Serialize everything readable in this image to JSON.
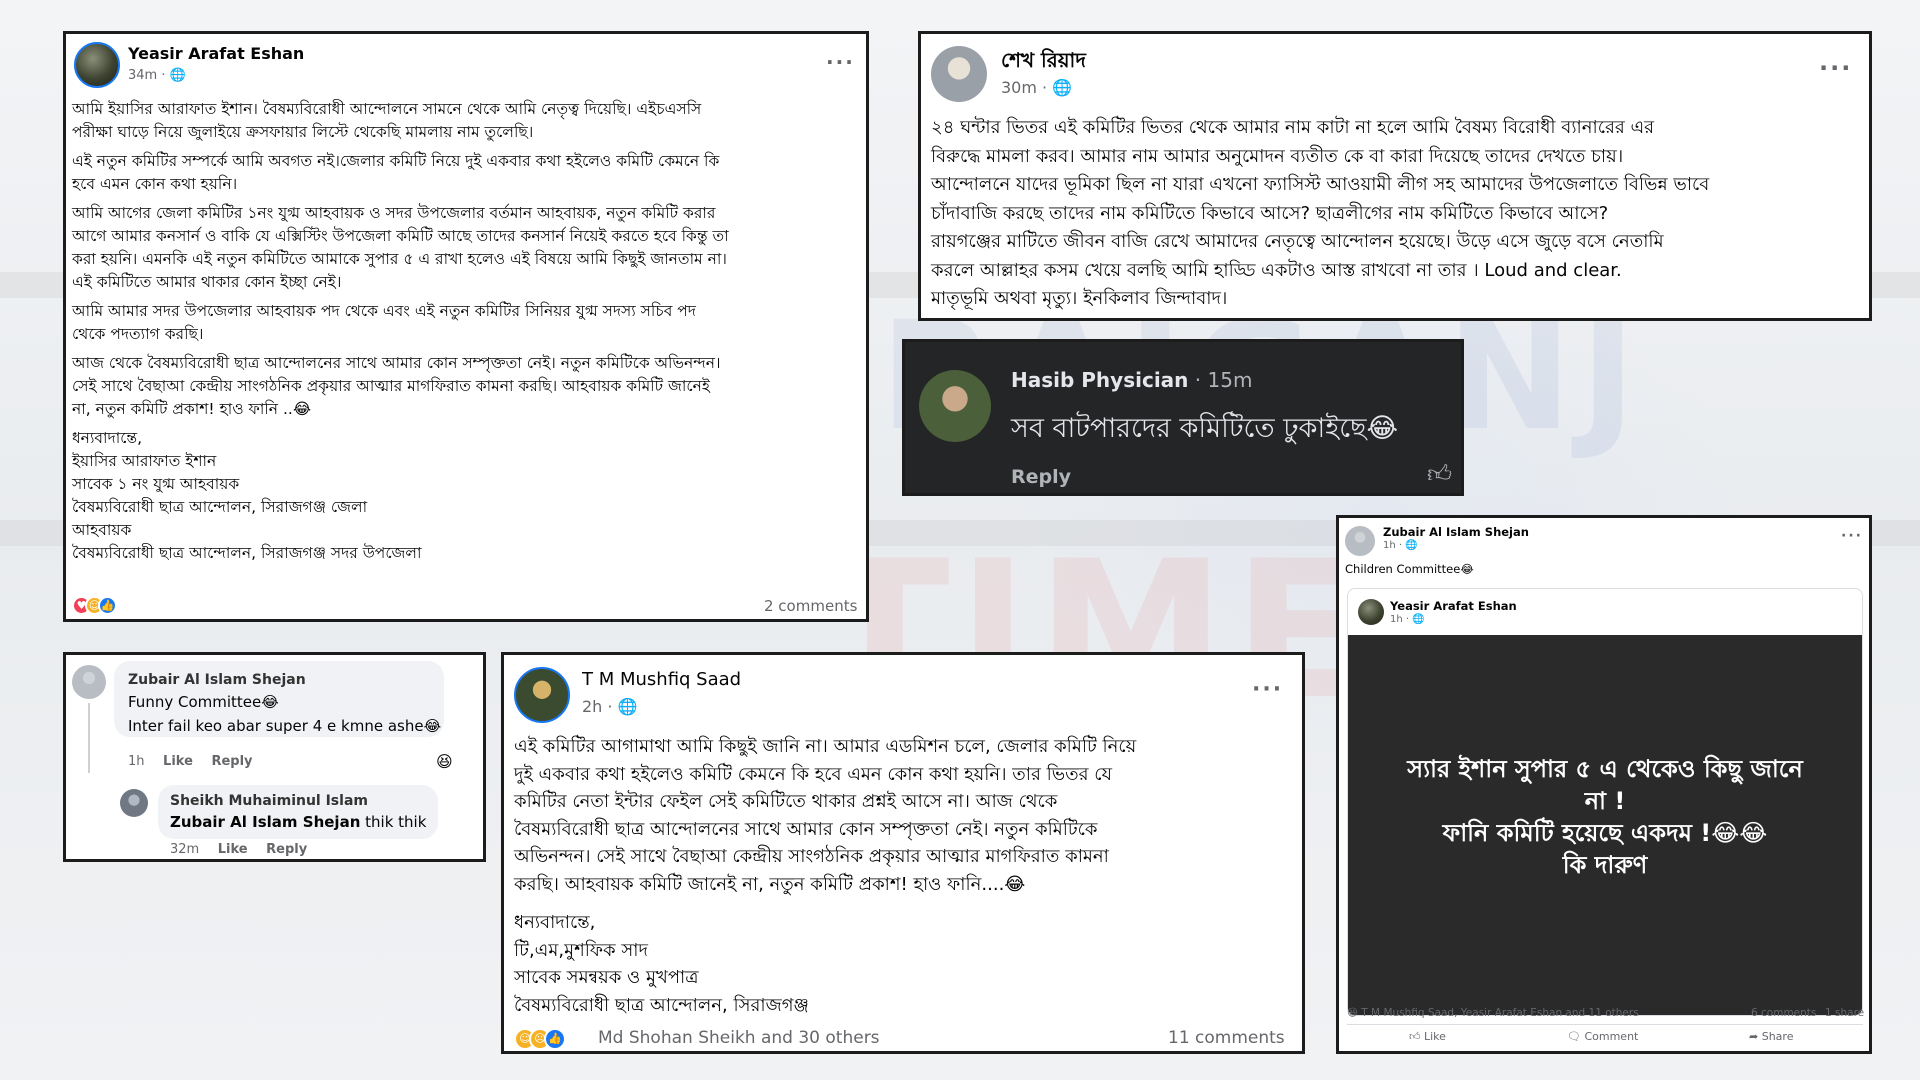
{
  "watermark": {
    "text_a": "SIRAJGANJ",
    "text_b": "TIMES"
  },
  "post1": {
    "author": "Yeasir Arafat Eshan",
    "time": "34m · ",
    "globe_icon": "globe-icon",
    "paragraphs": [
      [
        "আমি ইয়াসির আরাফাত ইশান। বৈষম্যবিরোধী আন্দোলনে সামনে থেকে আমি নেতৃত্ব দিয়েছি। এইচএসসি",
        "পরীক্ষা ঘাড়ে নিয়ে জুলাইয়ে ক্রসফায়ার লিস্টে থেকেছি মামলায় নাম তুলেছি।"
      ],
      [
        "এই নতুন কমিটির সম্পর্কে আমি অবগত নই।জেলার কমিটি নিয়ে দুই একবার কথা হইলেও কমিটি কেমনে কি",
        "হবে এমন কোন কথা হয়নি।"
      ],
      [
        "আমি আগের জেলা কমিটির ১নং যুগ্ম আহবায়ক ও সদর উপজেলার বর্তমান আহবায়ক, নতুন কমিটি করার",
        "আগে আমার কনসার্ন ও বাকি যে এক্সিস্টিং উপজেলা কমিটি আছে তাদের কনসার্ন নিয়েই করতে হবে কিন্তু তা",
        "করা হয়নি। এমনকি এই নতুন কমিটিতে আমাকে সুপার ৫ এ রাখা হলেও এই বিষয়ে আমি কিছুই জানতাম না।",
        "এই কমিটিতে আমার থাকার কোন ইচ্ছা নেই।"
      ],
      [
        "আমি আমার সদর উপজেলার আহবায়ক পদ থেকে এবং এই নতুন কমিটির সিনিয়র যুগ্ম সদস্য সচিব পদ",
        "থেকে পদত্যাগ করছি।"
      ],
      [
        "আজ থেকে বৈষম্যবিরোধী ছাত্র আন্দোলনের সাথে আমার কোন সম্পৃক্ততা নেই। নতুন কমিটিকে অভিনন্দন।",
        "সেই সাথে বৈছাআ কেন্দ্রীয় সাংগঠনিক প্রকৃয়ার আত্মার মাগফিরাত কামনা করছি। আহবায়ক কমিটি জানেই",
        "না, নতুন কমিটি প্রকাশ! হাও ফানি ..😂"
      ],
      [
        "ধন্যবাদান্তে,",
        "ইয়াসির আরাফাত ইশান",
        "সাবেক ১ নং যুগ্ম আহবায়ক",
        "বৈষম্যবিরোধী ছাত্র আন্দোলন, সিরাজগঞ্জ জেলা",
        "আহবায়ক",
        "বৈষম্যবিরোধী ছাত্র আন্দোলন, সিরাজগঞ্জ সদর উপজেলা"
      ]
    ],
    "comments": "2 comments"
  },
  "post2": {
    "author": "শেখ রিয়াদ",
    "time": "30m · ",
    "lines": [
      "২৪ ঘন্টার ভিতর এই কমিটির ভিতর থেকে আমার নাম কাটা না হলে আমি বৈষম্য বিরোধী ব্যানারের এর",
      "বিরুদ্ধে মামলা করব। আমার নাম আমার অনুমোদন ব্যতীত কে বা কারা দিয়েছে তাদের দেখতে চায়।",
      "আন্দোলনে যাদের ভূমিকা ছিল না যারা এখনো ফ্যাসিস্ট আওয়ামী লীগ সহ আমাদের উপজেলাতে বিভিন্ন ভাবে",
      "চাঁদাবাজি করছে তাদের নাম কমিটিতে কিভাবে আসে? ছাত্রলীগের নাম কমিটিতে কিভাবে আসে?",
      "রায়গঞ্জের মাটিতে জীবন বাজি রেখে আমাদের নেতৃত্বে আন্দোলন হয়েছে। উড়ে এসে জুড়ে বসে  নেতামি",
      "করলে আল্লাহর কসম খেয়ে বলছি আমি হাড্ডি একটাও আস্ত রাখবো না তার । Loud and clear.",
      "মাতৃভূমি অথবা মৃত্যু। ইনকিলাব জিন্দাবাদ।"
    ]
  },
  "comment_dark": {
    "author": "Hasib Physician",
    "time": " · 15m",
    "text": "সব বাটপারদের কমিটিতে ঢুকাইছে😂",
    "reply": "Reply",
    "like_icon": "thumbs-up-icon"
  },
  "post3": {
    "author": "Zubair Al Islam Shejan",
    "time": "1h · ",
    "caption": "Children Committee😂",
    "shared_author": "Yeasir Arafat Eshan",
    "shared_time": "1h · ",
    "image_lines": [
      "স্যার ইশান সুপার ৫ এ থেকেও কিছু জানে",
      "না !",
      "ফানি কমিটি হয়েছে একদম !😂😂",
      "কি দারুণ"
    ],
    "reactors": "T M Mushfiq Saad, Yeasir Arafat Eshan and 11 others",
    "comments": "6 comments",
    "shares": "1 share",
    "actions": [
      "Like",
      "Comment",
      "Share"
    ]
  },
  "comment_thread": {
    "c1_author": "Zubair Al Islam Shejan",
    "c1_lines": [
      "Funny Committee😂",
      "Inter fail keo abar super 4 e kmne ashe😂"
    ],
    "c1_time": "1h",
    "c1_like": "Like",
    "c1_reply": "Reply",
    "c2_author": "Sheikh Muhaiminul Islam",
    "c2_mention": "Zubair Al Islam Shejan",
    "c2_text": " thik thik",
    "c2_time": "32m",
    "c2_like": "Like",
    "c2_reply": "Reply"
  },
  "post4": {
    "author": "T M Mushfiq Saad",
    "time": "2h · ",
    "lines": [
      "এই কমিটির আগামাথা আমি কিছুই জানি না। আমার এডমিশন চলে, জেলার কমিটি নিয়ে",
      "দুই একবার কথা হইলেও কমিটি কেমনে কি হবে এমন কোন কথা হয়নি। তার ভিতর যে",
      "কমিটির নেতা ইন্টার ফেইল সেই কমিটিতে থাকার প্রশ্নই আসে না। আজ থেকে",
      "বৈষম্যবিরোধী ছাত্র আন্দোলনের সাথে আমার কোন সম্পৃক্ততা নেই। নতুন কমিটিকে",
      "অভিনন্দন। সেই সাথে বৈছাআ কেন্দ্রীয় সাংগঠনিক প্রকৃয়ার আত্মার মাগফিরাত কামনা",
      "করছি। আহবায়ক কমিটি জানেই না, নতুন কমিটি প্রকাশ! হাও ফানি....😂"
    ],
    "sign_lines": [
      "ধন্যবাদান্তে,",
      "টি,এম,মুশফিক সাদ",
      "সাবেক সমন্বয়ক ও মুখপাত্র",
      "বৈষম্যবিরোধী ছাত্র আন্দোলন, সিরাজগঞ্জ"
    ],
    "reactors": "Md Shohan Sheikh and 30 others",
    "comments": "11 comments"
  }
}
